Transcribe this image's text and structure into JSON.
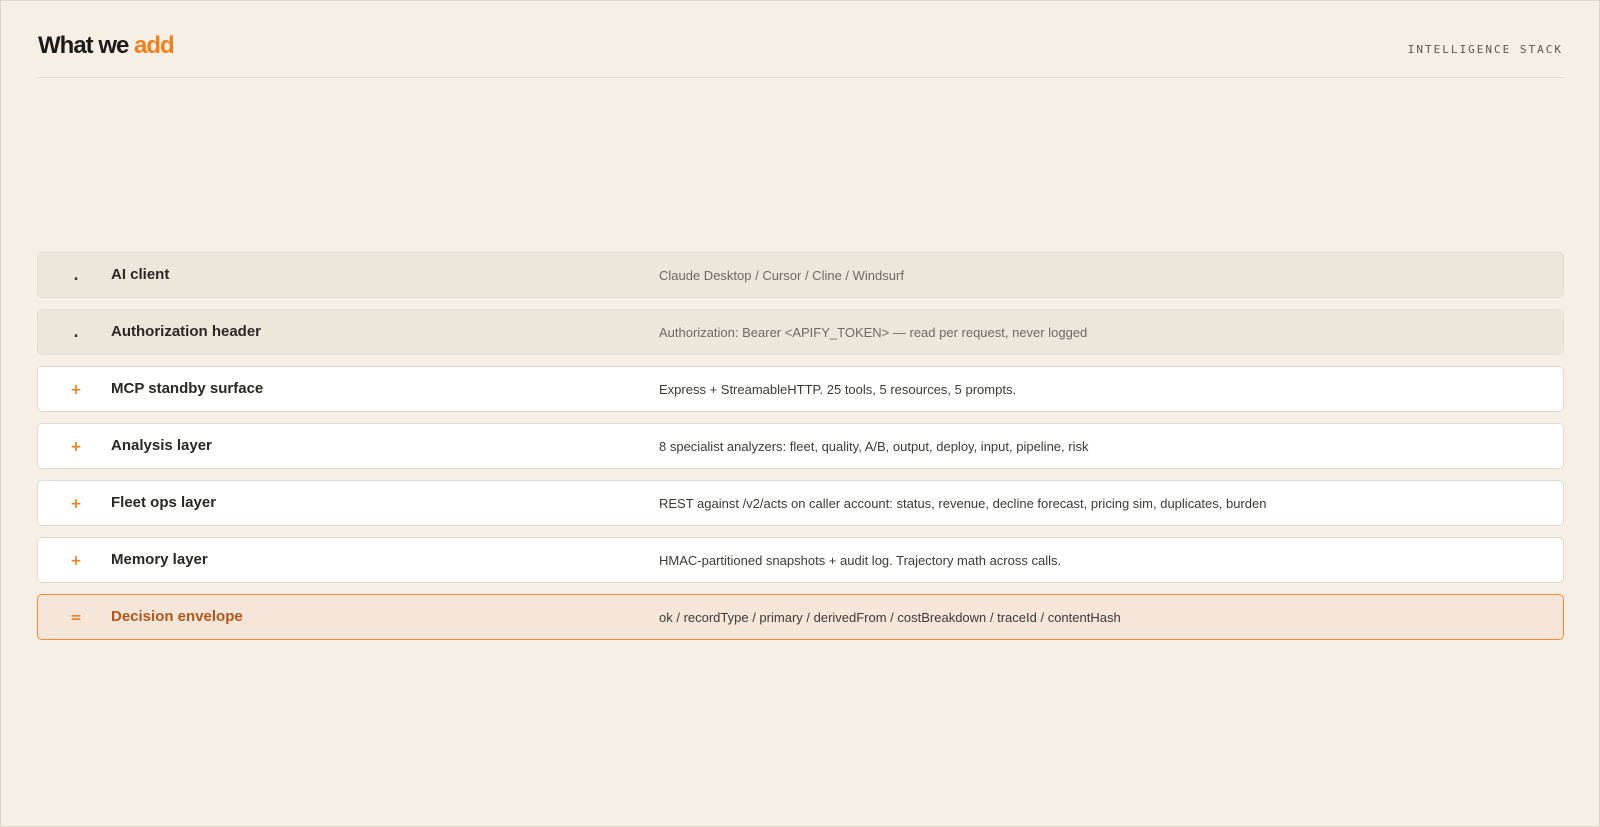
{
  "header": {
    "title_main": "What we ",
    "title_accent": "add",
    "subtitle": "INTELLIGENCE STACK"
  },
  "colors": {
    "accent": "#f07f1f",
    "background": "#f5efe5",
    "existing_row": "#ede6db",
    "added_row": "#ffffff",
    "result_row": "#f5e6d9",
    "result_text": "#b4561a"
  },
  "stack": [
    {
      "marker": ".",
      "kind": "existing",
      "name": "AI client",
      "description": "Claude Desktop / Cursor / Cline / Windsurf"
    },
    {
      "marker": ".",
      "kind": "existing",
      "name": "Authorization header",
      "description": "Authorization: Bearer <APIFY_TOKEN> — read per request, never logged"
    },
    {
      "marker": "+",
      "kind": "added",
      "name": "MCP standby surface",
      "description": "Express + StreamableHTTP. 25 tools, 5 resources, 5 prompts."
    },
    {
      "marker": "+",
      "kind": "added",
      "name": "Analysis layer",
      "description": "8 specialist analyzers: fleet, quality, A/B, output, deploy, input, pipeline, risk"
    },
    {
      "marker": "+",
      "kind": "added",
      "name": "Fleet ops layer",
      "description": "REST against /v2/acts on caller account: status, revenue, decline forecast, pricing sim, duplicates, burden"
    },
    {
      "marker": "+",
      "kind": "added",
      "name": "Memory layer",
      "description": "HMAC-partitioned snapshots + audit log. Trajectory math across calls."
    },
    {
      "marker": "=",
      "kind": "result",
      "name": "Decision envelope",
      "description": "ok / recordType / primary / derivedFrom / costBreakdown / traceId / contentHash"
    }
  ]
}
